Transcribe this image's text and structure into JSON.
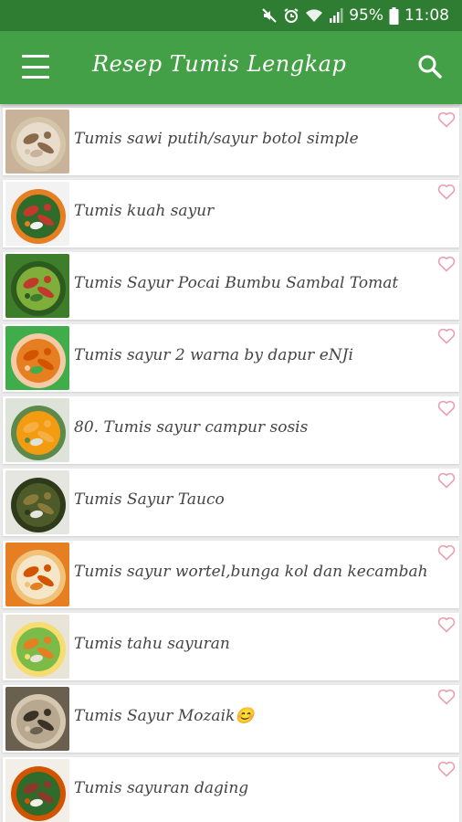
{
  "status_bar": {
    "battery": "95%",
    "time": "11:08",
    "icons": [
      "mute-icon",
      "alarm-icon",
      "wifi-icon",
      "signal-icon",
      "battery-icon"
    ]
  },
  "app_bar": {
    "title": "Resep Tumis Lengkap",
    "menu_icon": "hamburger-menu-icon",
    "search_icon": "search-icon",
    "color": "#43a047",
    "status_color": "#2e7d32"
  },
  "recipes": [
    {
      "title": "Tumis sawi putih/sayur botol simple",
      "thumb_palette": [
        "#c9b29a",
        "#e8dccc",
        "#8a6a4a",
        "#d4c4a8"
      ]
    },
    {
      "title": "Tumis kuah sayur",
      "thumb_palette": [
        "#f2f2f2",
        "#2f6b2a",
        "#c0392b",
        "#e67e22"
      ]
    },
    {
      "title": "Tumis Sayur Pocai Bumbu Sambal Tomat",
      "thumb_palette": [
        "#3e7d2a",
        "#7fae3a",
        "#c0392b",
        "#2d5a1e"
      ]
    },
    {
      "title": "Tumis sayur 2 warna by dapur eNJi",
      "thumb_palette": [
        "#3fae4a",
        "#e67e22",
        "#d35400",
        "#f5cba7"
      ]
    },
    {
      "title": "80. Tumis sayur campur sosis",
      "thumb_palette": [
        "#dde3d8",
        "#f39c12",
        "#f5b041",
        "#5d8a4a"
      ]
    },
    {
      "title": "Tumis Sayur Tauco",
      "thumb_palette": [
        "#e6e6e0",
        "#4d5a2a",
        "#8a7a3a",
        "#2f3a1a"
      ]
    },
    {
      "title": "Tumis sayur wortel,bunga kol dan kecambah",
      "thumb_palette": [
        "#e67e22",
        "#f5e6c8",
        "#d35400",
        "#f0c27a"
      ]
    },
    {
      "title": "Tumis tahu sayuran",
      "thumb_palette": [
        "#e8e4d8",
        "#7dbb48",
        "#e67e22",
        "#f7dc6f"
      ]
    },
    {
      "title": "Tumis Sayur Mozaik😊",
      "thumb_palette": [
        "#6a6050",
        "#b8a890",
        "#3a3226",
        "#d6c8b0"
      ]
    },
    {
      "title": "Tumis sayuran daging",
      "thumb_palette": [
        "#f2efe8",
        "#2f6b2a",
        "#8a3a2a",
        "#d35400"
      ]
    }
  ]
}
